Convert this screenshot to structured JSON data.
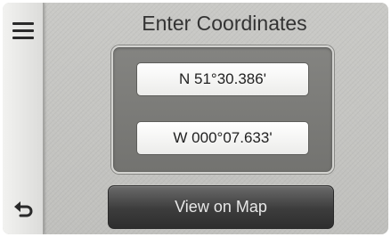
{
  "header": {
    "title": "Enter Coordinates"
  },
  "sidebar": {
    "menu_icon": "menu-icon",
    "back_icon": "back-icon"
  },
  "coordinates": {
    "latitude": "N 51°30.386'",
    "longitude": "W 000°07.633'"
  },
  "actions": {
    "view_on_map_label": "View on Map"
  }
}
